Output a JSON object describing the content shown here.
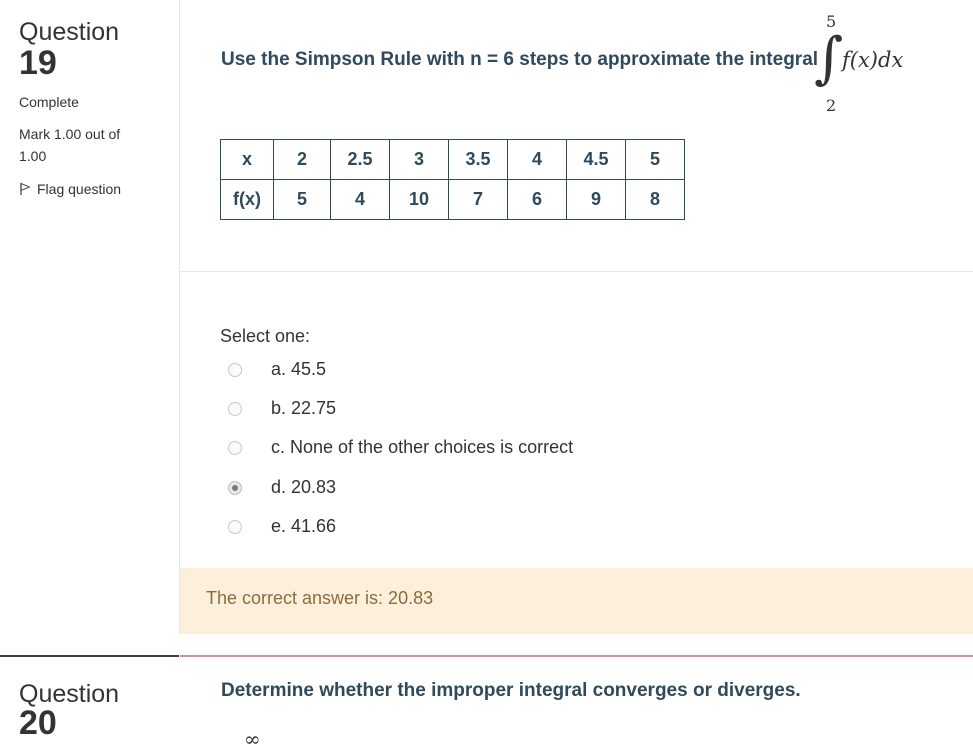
{
  "question19": {
    "label": "Question",
    "number": "19",
    "status": "Complete",
    "mark_line1": "Mark 1.00 out of",
    "mark_line2": "1.00",
    "flag_label": "Flag question",
    "prompt": "Use the Simpson Rule with n = 6 steps to approximate the integral",
    "integral": {
      "upper": "5",
      "lower": "2",
      "sign": "∫",
      "integrand": "f(x)dx"
    },
    "table": {
      "x_header": "x",
      "fx_header": "f(x)",
      "x": [
        "2",
        "2.5",
        "3",
        "3.5",
        "4",
        "4.5",
        "5"
      ],
      "fx": [
        "5",
        "4",
        "10",
        "7",
        "6",
        "9",
        "8"
      ]
    },
    "select_label": "Select one:",
    "options": [
      {
        "label": "a. 45.5",
        "selected": false
      },
      {
        "label": "b. 22.75",
        "selected": false
      },
      {
        "label": "c. None of the other choices is correct",
        "selected": false
      },
      {
        "label": "d. 20.83",
        "selected": true
      },
      {
        "label": "e. 41.66",
        "selected": false
      }
    ],
    "feedback": "The correct answer is: 20.83"
  },
  "question20": {
    "label": "Question",
    "number": "20",
    "prompt": "Determine whether the improper integral converges or diverges.",
    "upper_limit": "∞"
  },
  "colors": {
    "question_text": "#2f4a5c",
    "feedback_bg": "#fcefdc",
    "feedback_text": "#8a6d3b",
    "separator_accent": "#e28b9b"
  }
}
